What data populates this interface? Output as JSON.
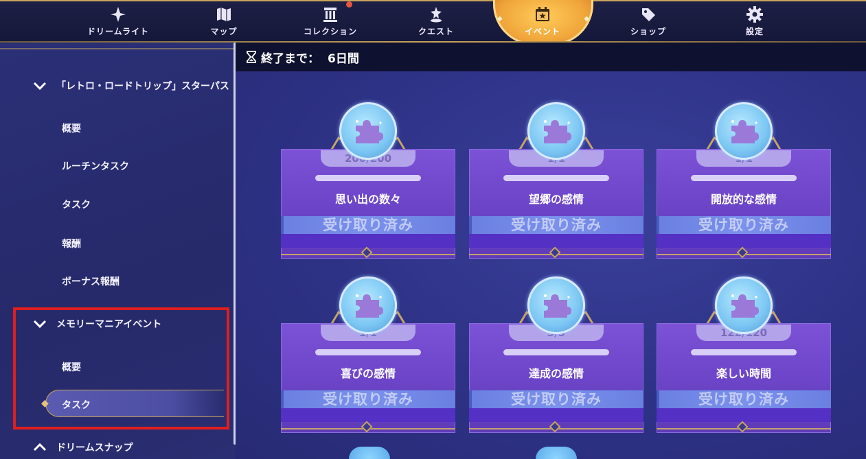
{
  "colors": {
    "nav_active": "#f0a53a",
    "highlight_box": "#e01e1e",
    "card_panel": "#6d45c8",
    "claimed_band": "#7b91ec",
    "gold_trim": "#c6a36a"
  },
  "nav": {
    "items": [
      {
        "label": "ドリームライト",
        "icon": "dreamlight-icon"
      },
      {
        "label": "マップ",
        "icon": "map-icon"
      },
      {
        "label": "コレクション",
        "icon": "collection-icon"
      },
      {
        "label": "クエスト",
        "icon": "quest-icon"
      },
      {
        "label": "イベント",
        "icon": "calendar-star-icon",
        "active": true
      },
      {
        "label": "ショップ",
        "icon": "price-tag-icon"
      },
      {
        "label": "設定",
        "icon": "gear-icon"
      }
    ]
  },
  "timer": {
    "label": "終了まで：",
    "value": "6日間",
    "icon": "hourglass-icon"
  },
  "sidebar": {
    "groups": [
      {
        "title": "「レトロ・ロードトリップ」スターパス",
        "expanded": true,
        "items": [
          "概要",
          "ルーチンタスク",
          "タスク",
          "報酬",
          "ボーナス報酬"
        ]
      },
      {
        "title": "メモリーマニアイベント",
        "expanded": true,
        "items": [
          "概要",
          "タスク"
        ],
        "selected_item": "タスク"
      },
      {
        "title": "ドリームスナップ",
        "expanded": false
      }
    ]
  },
  "cards": [
    {
      "count": "200/200",
      "title": "思い出の数々",
      "status": "受け取り済み",
      "progress": 1.0,
      "icon": "puzzle-piece-icon"
    },
    {
      "count": "1/1",
      "title": "望郷の感情",
      "status": "受け取り済み",
      "progress": 1.0,
      "icon": "puzzle-piece-icon"
    },
    {
      "count": "1/1",
      "title": "開放的な感情",
      "status": "受け取り済み",
      "progress": 1.0,
      "icon": "puzzle-piece-icon"
    },
    {
      "count": "1/1",
      "title": "喜びの感情",
      "status": "受け取り済み",
      "progress": 1.0,
      "icon": "puzzle-piece-icon"
    },
    {
      "count": "3/3",
      "title": "達成の感情",
      "status": "受け取り済み",
      "progress": 1.0,
      "icon": "puzzle-piece-icon"
    },
    {
      "count": "122/120",
      "title": "楽しい時間",
      "status": "受け取り済み",
      "progress": 1.0,
      "icon": "puzzle-piece-icon"
    }
  ]
}
